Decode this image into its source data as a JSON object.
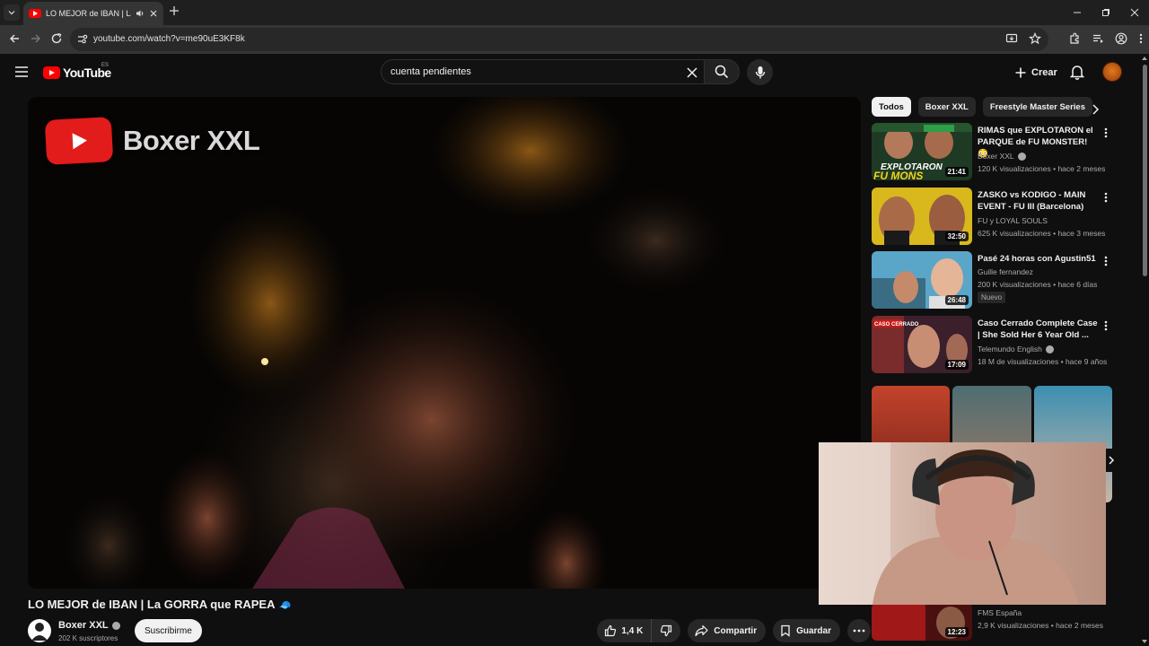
{
  "browser": {
    "tab_title": "LO MEJOR de IBAN | La GO",
    "url": "youtube.com/watch?v=me90uE3KF8k",
    "icons": [
      "tab-list-icon",
      "youtube-favicon-icon",
      "audio-icon",
      "close-icon",
      "new-tab-icon",
      "minimize-icon",
      "restore-icon",
      "close-window-icon",
      "back-icon",
      "forward-icon",
      "reload-icon",
      "site-info-icon",
      "install-app-icon",
      "bookmark-star-icon",
      "extensions-icon",
      "media-controls-icon",
      "profile-icon",
      "kebab-menu-icon"
    ]
  },
  "masthead": {
    "logo_text": "YouTube",
    "country_code": "ES",
    "search_value": "cuenta pendientes",
    "create_label": "Crear"
  },
  "player": {
    "watermark_text": "Boxer XXL"
  },
  "video": {
    "title": "LO MEJOR de IBAN | La GORRA que RAPEA",
    "title_emoji": "🧢",
    "channel_name": "Boxer XXL",
    "subscribers": "202 K suscriptores",
    "subscribe_label": "Suscribirme",
    "likes": "1,4 K",
    "share_label": "Compartir",
    "save_label": "Guardar"
  },
  "chips": [
    "Todos",
    "Boxer XXL",
    "Freestyle Master Series"
  ],
  "recommendations": [
    {
      "title": "RIMAS que EXPLOTARON el PARQUE de FU MONSTER! 😳",
      "channel": "Boxer XXL",
      "verified": true,
      "meta": "120 K visualizaciones • hace 2 meses",
      "duration": "21:41",
      "thumb_text": "EXPLOTARON FU MONS"
    },
    {
      "title": "ZASKO vs KODIGO - MAIN EVENT - FU III (Barcelona)",
      "channel": "FU y LOYAL SOULS",
      "verified": false,
      "meta": "625 K visualizaciones • hace 3 meses",
      "duration": "32:50"
    },
    {
      "title": "Pasé 24 horas con Agustin51",
      "channel": "Guille fernandez",
      "verified": false,
      "meta": "200 K visualizaciones • hace 6 días",
      "badge": "Nuevo",
      "duration": "26:48"
    },
    {
      "title": "Caso Cerrado Complete Case | She Sold Her 6 Year Old ...",
      "channel": "Telemundo English",
      "verified": true,
      "meta": "18 M de visualizaciones • hace 9 años",
      "duration": "17:09",
      "thumb_text": "CASO CERRADO"
    },
    {
      "title": "",
      "channel": "FMS España",
      "verified": false,
      "meta": "2,9 K visualizaciones • hace 2 meses",
      "duration": "12:23"
    }
  ],
  "colors": {
    "background": "#0f0f0f",
    "brand_red": "#ff0000",
    "text": "#f1f1f1",
    "secondary_text": "#aaaaaa"
  }
}
